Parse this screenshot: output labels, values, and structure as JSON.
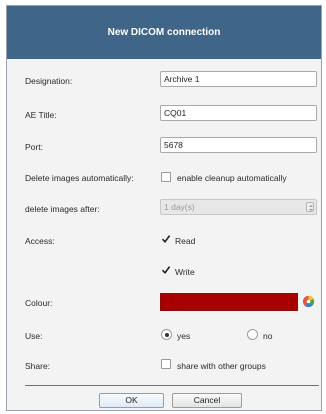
{
  "dialog": {
    "title": "New DICOM connection"
  },
  "form": {
    "designation": {
      "label": "Designation:",
      "value": "Archive 1"
    },
    "ae_title": {
      "label": "AE Title:",
      "value": "CQ01"
    },
    "port": {
      "label": "Port:",
      "value": "5678"
    },
    "delete_auto": {
      "label": "Delete images automatically:",
      "checkbox_label": "enable cleanup automatically",
      "checked": false
    },
    "delete_after": {
      "label": "delete images after:",
      "value": "1 day(s)",
      "disabled": true
    },
    "access": {
      "label": "Access:",
      "read_label": "Read",
      "read_checked": true,
      "write_label": "Write",
      "write_checked": true
    },
    "colour": {
      "label": "Colour:",
      "value": "#a80000",
      "icon": "color-picker-icon"
    },
    "use": {
      "label": "Use:",
      "yes_label": "yes",
      "no_label": "no",
      "selected": "yes"
    },
    "share": {
      "label": "Share:",
      "checkbox_label": "share with other groups",
      "checked": false
    }
  },
  "buttons": {
    "ok": "OK",
    "cancel": "Cancel"
  }
}
